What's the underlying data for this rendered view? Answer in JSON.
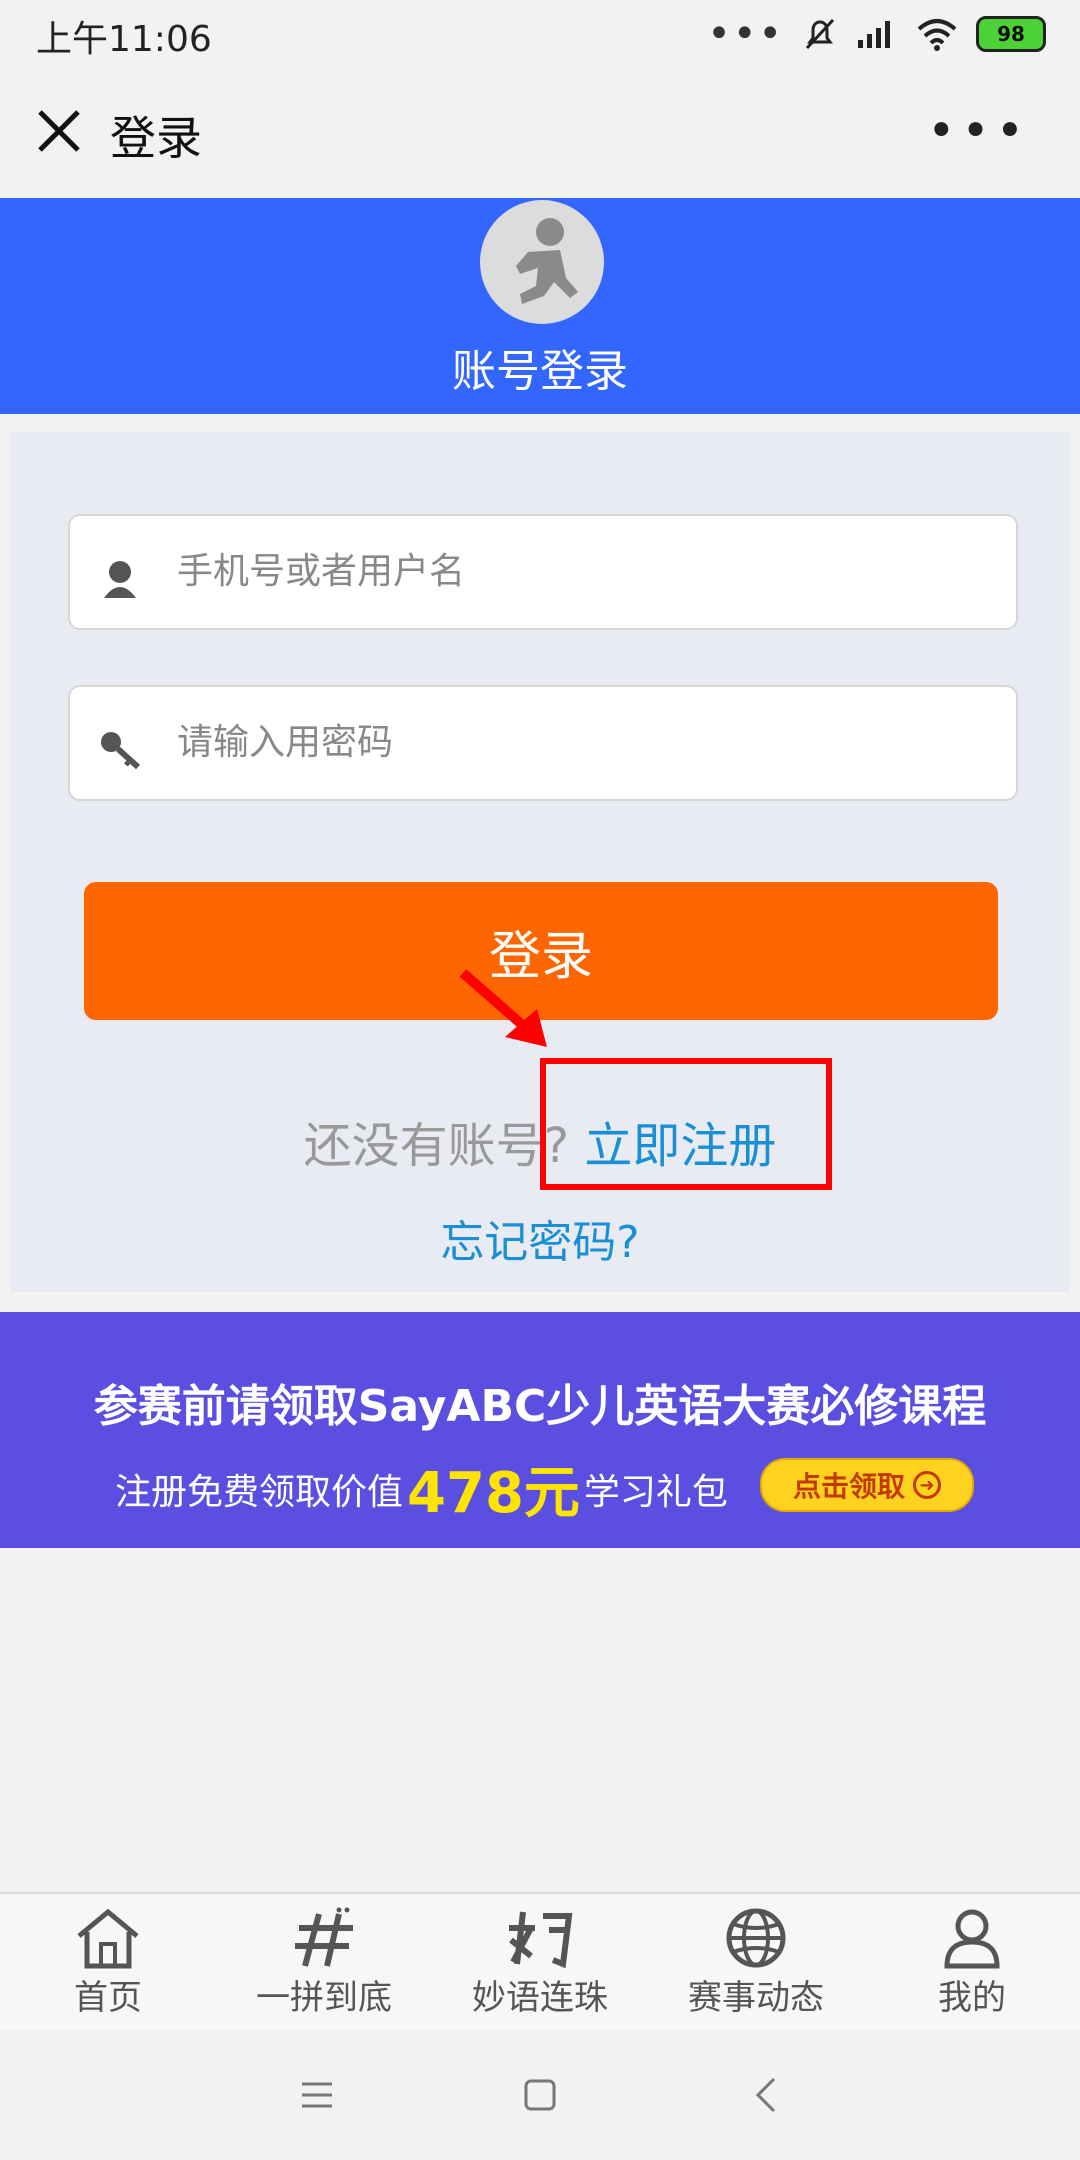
{
  "status_bar": {
    "time": "上午11:06",
    "battery": "98"
  },
  "nav": {
    "title": "登录"
  },
  "header": {
    "title": "账号登录"
  },
  "form": {
    "username_placeholder": "手机号或者用户名",
    "password_placeholder": "请输入用密码",
    "login_label": "登录",
    "no_account_text": "还没有账号?",
    "register_link": "立即注册",
    "forgot_link": "忘记密码?"
  },
  "banner": {
    "line1": "参赛前请领取SayABC少儿英语大赛必修课程",
    "line2_prefix": "注册免费领取价值",
    "amount": "478元",
    "line2_suffix": "学习礼包",
    "claim_label": "点击领取"
  },
  "tabs": [
    {
      "label": "首页",
      "icon": "home-icon"
    },
    {
      "label": "一拼到底",
      "icon": "pin-icon"
    },
    {
      "label": "妙语连珠",
      "icon": "miao-icon"
    },
    {
      "label": "赛事动态",
      "icon": "globe-icon"
    },
    {
      "label": "我的",
      "icon": "profile-icon"
    }
  ],
  "colors": {
    "header_blue": "#3366ff",
    "login_orange": "#ff6600",
    "link_blue": "#1a8fd6",
    "banner_purple": "#5a4fe0",
    "highlight_red": "#ff0000"
  }
}
